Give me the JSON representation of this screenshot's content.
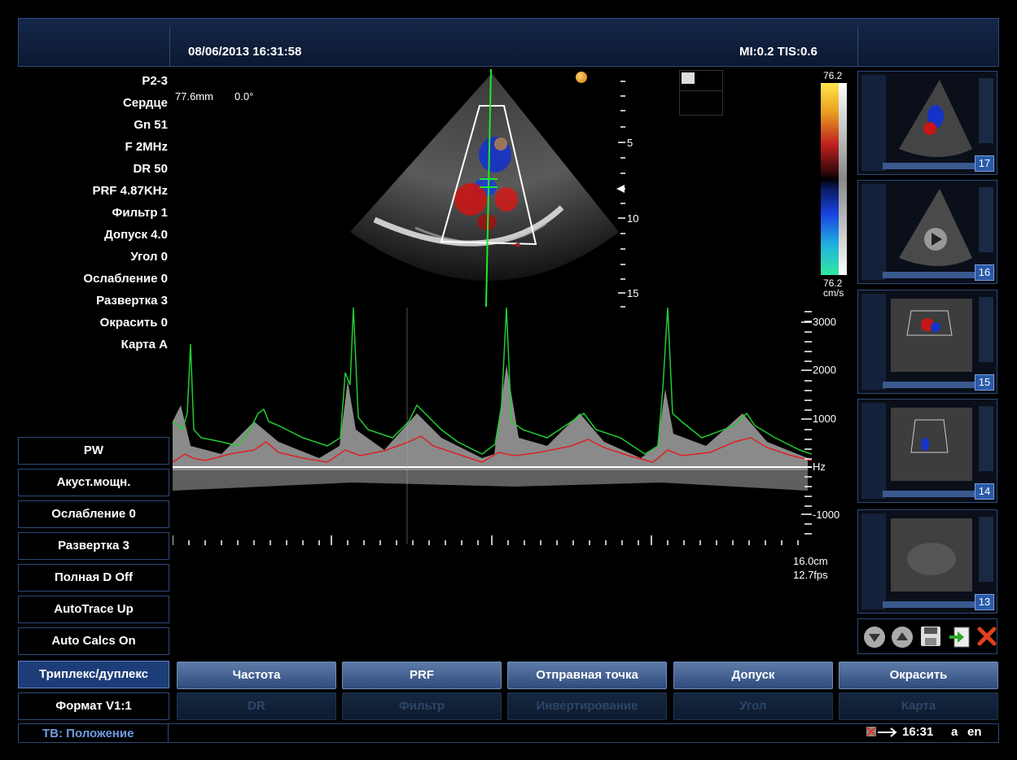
{
  "header": {
    "datetime": "08/06/2013 16:31:58",
    "mi_tis": "MI:0.2 TIS:0.6"
  },
  "params": [
    "P2-3",
    "Сердце",
    "Gn 51",
    "F 2MHz",
    "DR 50",
    "PRF 4.87KHz",
    "Фильтр 1",
    "Допуск 4.0",
    "Угол 0",
    "Ослабление 0",
    "Развертка 3",
    "Окрасить 0",
    "Карта A"
  ],
  "image_info": {
    "depth_mm": "77.6mm",
    "angle": "0.0°"
  },
  "depth_scale": [
    "5",
    "10",
    "15"
  ],
  "colorbar": {
    "top": "76.2",
    "bottom": "76.2",
    "unit": "cm/s"
  },
  "spectral_scale": [
    "3000",
    "2000",
    "1000",
    "Hz",
    "-1000"
  ],
  "scan_info": {
    "depth": "16.0cm",
    "fps": "12.7fps"
  },
  "left_menu": [
    {
      "label": "PW",
      "active": false
    },
    {
      "label": "Акуст.мощн.",
      "active": false
    },
    {
      "label": "Ослабление  0",
      "active": false
    },
    {
      "label": "Развертка  3",
      "active": false
    },
    {
      "label": "Полная D  Off",
      "active": false
    },
    {
      "label": "AutoTrace  Up",
      "active": false
    },
    {
      "label": "Auto Calcs  On",
      "active": false
    },
    {
      "label": "Триплекс/дуплекс",
      "active": true
    },
    {
      "label": "Формат  V1:1",
      "active": false
    }
  ],
  "bottom_row1": [
    "Частота",
    "PRF",
    "Отправная точка",
    "Допуск",
    "Окрасить"
  ],
  "bottom_row2": [
    "DR",
    "Фильтр",
    "Инвертирование",
    "Угол",
    "Карта"
  ],
  "thumbnails": [
    "17",
    "16",
    "15",
    "14",
    "13"
  ],
  "thumb_controls": [
    "scroll-down-icon",
    "scroll-up-icon",
    "save-icon",
    "export-icon",
    "delete-icon"
  ],
  "status": {
    "tb_label": "ТВ: Положение",
    "time": "16:31",
    "lang_a": "a",
    "lang_en": "en"
  },
  "colors": {
    "trace_max": "#22cc33",
    "trace_mean": "#dd2222",
    "panel_border": "#2d4a7a",
    "accent_blue": "#6e9be0"
  }
}
